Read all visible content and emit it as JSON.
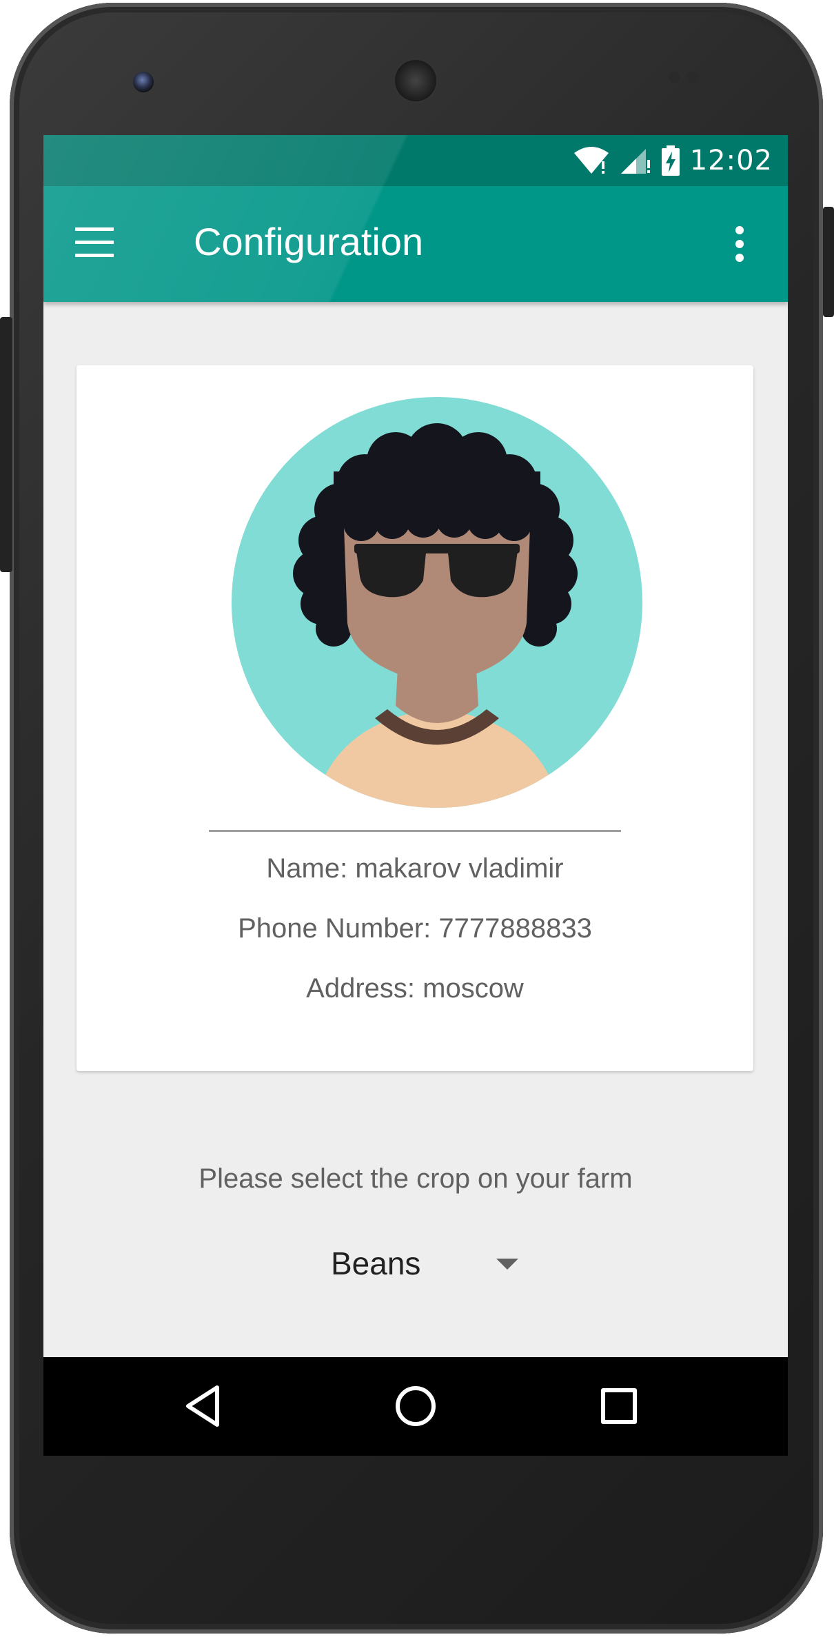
{
  "status_bar": {
    "time": "12:02",
    "icons": [
      "wifi-icon",
      "cell-signal-icon",
      "battery-charging-icon"
    ]
  },
  "app_bar": {
    "title": "Configuration",
    "menu_icon": "hamburger-menu-icon",
    "overflow_icon": "more-vert-icon"
  },
  "profile": {
    "avatar_icon": "avatar-icon",
    "name_line": "Name: makarov vladimir",
    "phone_line": "Phone Number: 7777888833",
    "address_line": "Address: moscow"
  },
  "crop": {
    "prompt": "Please select the crop on your farm",
    "selected": "Beans"
  },
  "nav_bar": {
    "icons": [
      "back-icon",
      "home-icon",
      "recents-icon"
    ]
  },
  "colors": {
    "status_bar": "#00796b",
    "app_bar": "#009688",
    "background": "#eeeeee",
    "avatar_bg": "#80dcd4"
  }
}
